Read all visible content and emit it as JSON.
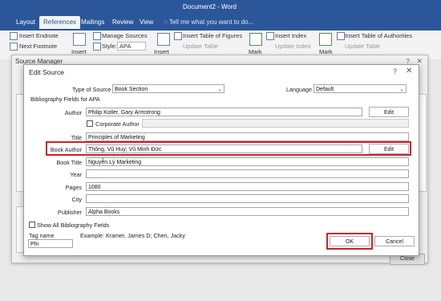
{
  "word": {
    "doc_title": "Document2 - Word",
    "tabs": [
      "Layout",
      "References",
      "Mailings",
      "Review",
      "View"
    ],
    "active_tab": "References",
    "tell_me": "Tell me what you want to do...",
    "ribbon": {
      "insert_endnote": "Insert Endnote",
      "next_footnote": "Next Footnote",
      "insert": "Insert",
      "manage_sources": "Manage Sources",
      "style_label": "Style:",
      "style_value": "APA",
      "insert2": "Insert",
      "insert_table_figures": "Insert Table of Figures",
      "update_table": "Update Table",
      "mark": "Mark",
      "insert_index": "Insert Index",
      "update_index": "Update Index",
      "mark2": "Mark",
      "insert_table_authorities": "Insert Table of Authorities",
      "update_table2": "Update Table"
    }
  },
  "source_manager": {
    "title": "Source Manager",
    "close_button": "Close",
    "help": "?",
    "close_x": "✕"
  },
  "edit_source": {
    "title": "Edit Source",
    "help": "?",
    "close_x": "✕",
    "type_label": "Type of Source",
    "type_value": "Book Section",
    "language_label": "Language",
    "language_value": "Default",
    "fields_header": "Bibliography Fields for APA",
    "author_label": "Author",
    "author_value": "Philip Kotler, Gary Armstrong",
    "edit_label": "Edit",
    "corporate_author_label": "Corporate Author",
    "title_label": "Title",
    "title_value": "Principles of Marketing",
    "book_author_label": "Book Author",
    "book_author_value": "Thông, Vũ Huy; Vũ Minh Đức",
    "edit2_label": "Edit",
    "book_title_label": "Book Title",
    "book_title_value": "Nguyễn Lý Marketing",
    "year_label": "Year",
    "year_value": "",
    "pages_label": "Pages",
    "pages_value": "1080",
    "city_label": "City",
    "city_value": "",
    "publisher_label": "Publisher",
    "publisher_value": "Alpha Books",
    "show_all_label": "Show All Bibliography Fields",
    "tag_name_label": "Tag name",
    "tag_value": "Phi",
    "example_label": "Example: Kramer, James D; Chen, Jacky",
    "ok_label": "OK",
    "cancel_label": "Cancel",
    "highlight_color": "#d0202a"
  }
}
